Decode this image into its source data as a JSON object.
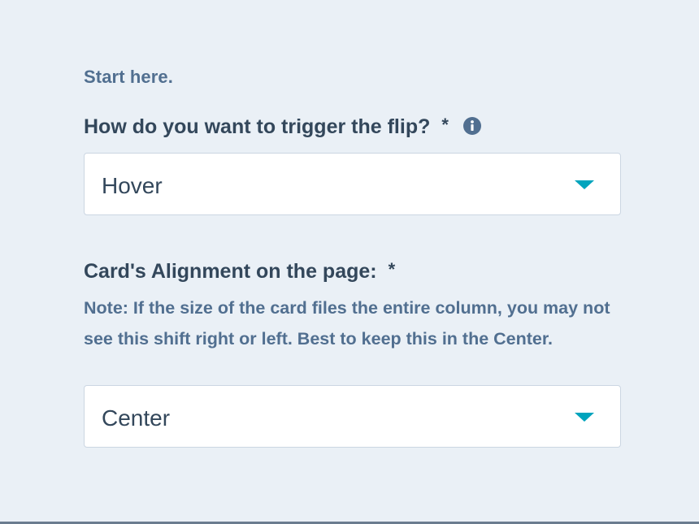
{
  "intro_text": "Start here.",
  "trigger_field": {
    "label": "How do you want to trigger the flip?",
    "required_mark": "*",
    "info_icon": "info-circle-icon",
    "value": "Hover",
    "caret_icon": "caret-down-icon"
  },
  "alignment_field": {
    "label": "Card's Alignment on the page:",
    "required_mark": "*",
    "help_text": "Note: If the size of the card files the entire column, you may not see this shift right or left. Best to keep this in the Center.",
    "value": "Center",
    "caret_icon": "caret-down-icon"
  },
  "colors": {
    "background": "#eaf0f6",
    "label_text": "#33475b",
    "muted_text": "#516f90",
    "accent": "#00a4bd",
    "input_border": "#cbd6e2"
  }
}
